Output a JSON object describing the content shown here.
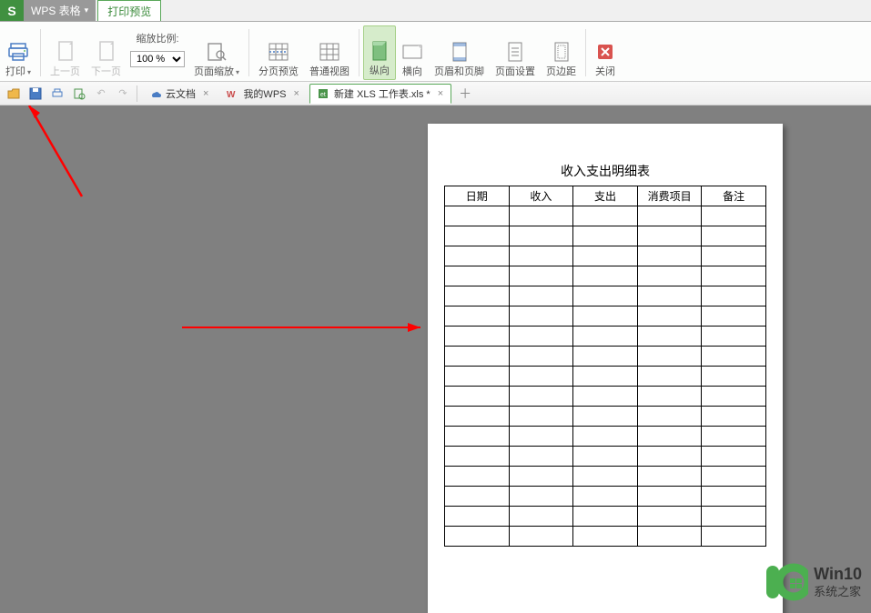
{
  "titlebar": {
    "logo": "S",
    "app_name": "WPS 表格",
    "preview_tab": "打印预览"
  },
  "ribbon": {
    "print": "打印",
    "prev_page": "上一页",
    "next_page": "下一页",
    "zoom_label": "缩放比例:",
    "zoom_value": "100 %",
    "page_zoom": "页面缩放",
    "page_break": "分页预览",
    "normal_view": "普通视图",
    "portrait": "纵向",
    "landscape": "横向",
    "header_footer": "页眉和页脚",
    "page_setup": "页面设置",
    "margins": "页边距",
    "close": "关闭"
  },
  "tabs": {
    "cloud": "云文档",
    "mywps": "我的WPS",
    "newxls": "新建 XLS 工作表.xls *"
  },
  "preview": {
    "title": "收入支出明细表",
    "headers": [
      "日期",
      "收入",
      "支出",
      "消费项目",
      "备注"
    ],
    "empty_rows": 17
  },
  "watermark": {
    "brand": "Win10",
    "site": "系统之家"
  }
}
